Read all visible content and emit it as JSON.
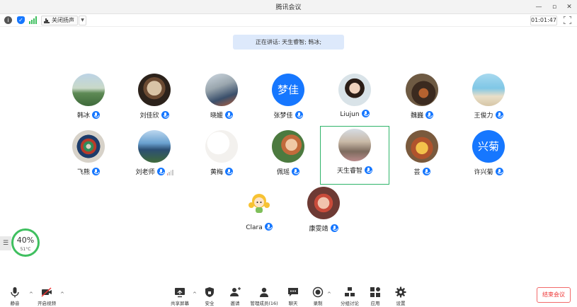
{
  "window": {
    "title": "腾讯会议"
  },
  "info_bar": {
    "speaker_toggle_label": "关闭扬声",
    "timer": "01:01:47"
  },
  "banner": {
    "text": "正在讲话: 天生睿智; 韩冰;"
  },
  "participants": [
    {
      "name": "韩冰",
      "avatar_text": ""
    },
    {
      "name": "刘佳欣",
      "avatar_text": ""
    },
    {
      "name": "晓媛",
      "avatar_text": ""
    },
    {
      "name": "张梦佳",
      "avatar_text": "梦佳"
    },
    {
      "name": "Liujun",
      "avatar_text": ""
    },
    {
      "name": "魏巍",
      "avatar_text": ""
    },
    {
      "name": "王俊力",
      "avatar_text": ""
    },
    {
      "name": "飞熊",
      "avatar_text": ""
    },
    {
      "name": "刘老师",
      "avatar_text": ""
    },
    {
      "name": "黄梅",
      "avatar_text": ""
    },
    {
      "name": "佩瑶",
      "avatar_text": ""
    },
    {
      "name": "天生睿智",
      "avatar_text": ""
    },
    {
      "name": "芸",
      "avatar_text": ""
    },
    {
      "name": "许兴菊",
      "avatar_text": "兴菊"
    },
    {
      "name": "Clara",
      "avatar_text": ""
    },
    {
      "name": "康雯靖",
      "avatar_text": ""
    }
  ],
  "cpu_widget": {
    "percent": "40%",
    "temp": "51°C"
  },
  "toolbar": {
    "mute": "静音",
    "video": "开启视频",
    "share": "共享屏幕",
    "security": "安全",
    "invite": "邀请",
    "members": "管理成员(16)",
    "chat": "聊天",
    "record": "录制",
    "breakout": "分组讨论",
    "apps": "应用",
    "settings": "设置",
    "end": "结束会议"
  },
  "colors": {
    "accent": "#1677ff",
    "active_border": "#2fb46a",
    "end_red": "#e33333"
  }
}
